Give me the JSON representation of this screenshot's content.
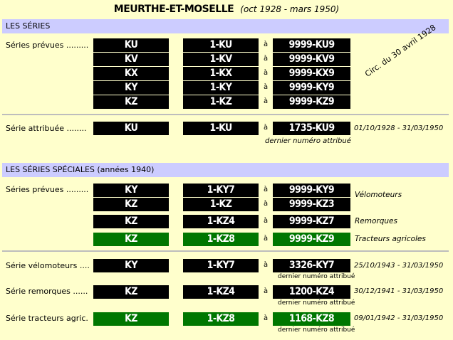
{
  "header": {
    "title": "MEURTHE-ET-MOSELLE",
    "subtitle": "(oct 1928 - mars 1950)"
  },
  "sections": {
    "series": "LES SÉRIES",
    "special": "LES SÉRIES SPÉCIALES (années 1940)"
  },
  "labels": {
    "prevues": "Séries prévues .........",
    "attribuee": "Série attribuée ........",
    "prevues2": "Séries prévues .........",
    "velo": "Série vélomoteurs ....",
    "remorques": "Série remorques ......",
    "tracteurs": "Série tracteurs agric."
  },
  "a_word": "à",
  "circ_note": "Circ. du 30 avril 1928",
  "last_attributed": "dernier numéro attribué",
  "rows": [
    {
      "s": "KU",
      "from": "1-KU",
      "to": "9999-KU9",
      "green": false
    },
    {
      "s": "KV",
      "from": "1-KV",
      "to": "9999-KV9",
      "green": false
    },
    {
      "s": "KX",
      "from": "1-KX",
      "to": "9999-KX9",
      "green": false
    },
    {
      "s": "KY",
      "from": "1-KY",
      "to": "9999-KY9",
      "green": false
    },
    {
      "s": "KZ",
      "from": "1-KZ",
      "to": "9999-KZ9",
      "green": false
    },
    {
      "s": "KU",
      "from": "1-KU",
      "to": "1735-KU9",
      "green": false,
      "date": "01/10/1928 - 31/03/1950"
    },
    {
      "s": "KY",
      "from": "1-KY7",
      "to": "9999-KY9",
      "green": false
    },
    {
      "s": "KZ",
      "from": "1-KZ",
      "to": "9999-KZ3",
      "green": false
    },
    {
      "s": "KZ",
      "from": "1-KZ4",
      "to": "9999-KZ7",
      "green": false
    },
    {
      "s": "KZ",
      "from": "1-KZ8",
      "to": "9999-KZ9",
      "green": true
    },
    {
      "s": "KY",
      "from": "1-KY7",
      "to": "3326-KY7",
      "green": false,
      "date": "25/10/1943 - 31/03/1950"
    },
    {
      "s": "KZ",
      "from": "1-KZ4",
      "to": "1200-KZ4",
      "green": false,
      "date": "30/12/1941 - 31/03/1950"
    },
    {
      "s": "KZ",
      "from": "1-KZ8",
      "to": "1168-KZ8",
      "green": true,
      "date": "09/01/1942 - 31/03/1950"
    }
  ],
  "special_notes": {
    "velomoteurs": "Vélomoteurs",
    "remorques": "Remorques",
    "tracteurs": "Tracteurs agricoles"
  },
  "colors": {
    "background": "#FFFFCC",
    "section": "#CCCCFF",
    "plate_black": "#000000",
    "plate_green": "#007700"
  }
}
